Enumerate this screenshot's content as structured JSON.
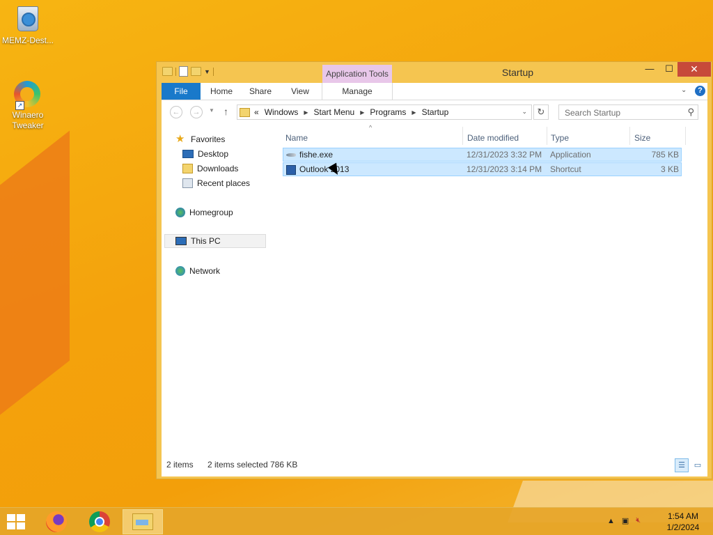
{
  "desktop": {
    "icons": [
      {
        "label": "MEMZ-Dest..."
      },
      {
        "label": "Winaero\nTweaker"
      }
    ]
  },
  "window": {
    "title": "Startup",
    "context_tab": "Application Tools",
    "ribbon_tabs": {
      "file": "File",
      "home": "Home",
      "share": "Share",
      "view": "View",
      "manage": "Manage"
    },
    "controls": {
      "minimize": "—",
      "maximize": "☐",
      "close": "✕"
    }
  },
  "address": {
    "prefix": "«",
    "crumbs": [
      "Windows",
      "Start Menu",
      "Programs",
      "Startup"
    ]
  },
  "search": {
    "placeholder": "Search Startup"
  },
  "navpane": {
    "favorites": "Favorites",
    "desktop": "Desktop",
    "downloads": "Downloads",
    "recent": "Recent places",
    "homegroup": "Homegroup",
    "thispc": "This PC",
    "network": "Network"
  },
  "columns": {
    "name": "Name",
    "date": "Date modified",
    "type": "Type",
    "size": "Size"
  },
  "files": [
    {
      "name": "fishe.exe",
      "date": "12/31/2023 3:32 PM",
      "type": "Application",
      "size": "785 KB",
      "icon": "fish-icon"
    },
    {
      "name": "Outlook 2013",
      "date": "12/31/2023 3:14 PM",
      "type": "Shortcut",
      "size": "3 KB",
      "icon": "shortcut-icon"
    }
  ],
  "status": {
    "count": "2 items",
    "selected": "2 items selected",
    "size": "786 KB"
  },
  "taskbar": {
    "time": "1:54 AM",
    "date": "1/2/2024"
  },
  "colors": {
    "file_tab": "#1979ca",
    "selection": "#cce8ff",
    "context_tab": "#e8c7e9",
    "close_button": "#c74a3a"
  }
}
